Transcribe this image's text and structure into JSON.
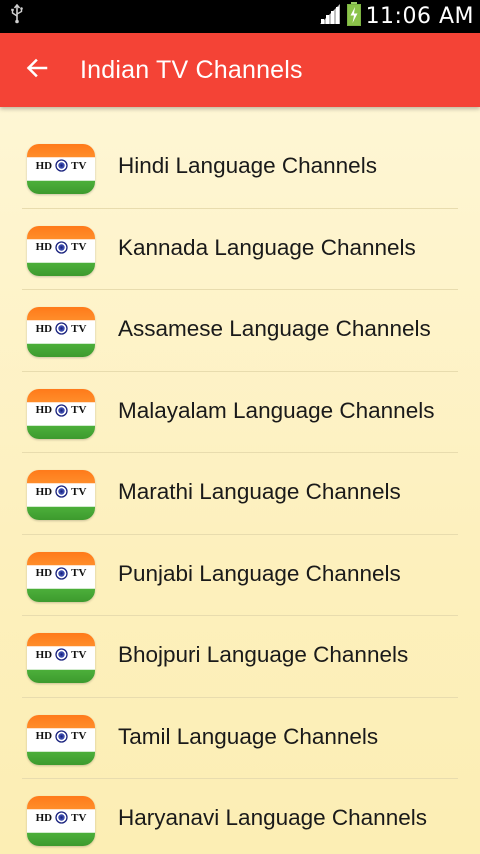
{
  "status_bar": {
    "time": "11:06 AM"
  },
  "app_bar": {
    "title": "Indian TV Channels"
  },
  "logo": {
    "left_text": "HD",
    "right_text": "TV"
  },
  "channels": [
    {
      "label": "Hindi Language Channels"
    },
    {
      "label": "Kannada Language Channels"
    },
    {
      "label": "Assamese Language Channels"
    },
    {
      "label": "Malayalam Language Channels"
    },
    {
      "label": "Marathi Language Channels"
    },
    {
      "label": "Punjabi Language Channels"
    },
    {
      "label": "Bhojpuri Language Channels"
    },
    {
      "label": "Tamil Language Channels"
    },
    {
      "label": "Haryanavi Language Channels"
    }
  ],
  "colors": {
    "app_bar": "#f44336",
    "saffron": "#ff7a1a",
    "green": "#4caf3a",
    "background": "#fdf3c4"
  },
  "icons": {
    "status_left": "usb-icon",
    "signal": "signal-strength-icon",
    "battery": "battery-charging-icon",
    "back": "arrow-back-icon",
    "chakra": "ashoka-chakra-icon"
  }
}
